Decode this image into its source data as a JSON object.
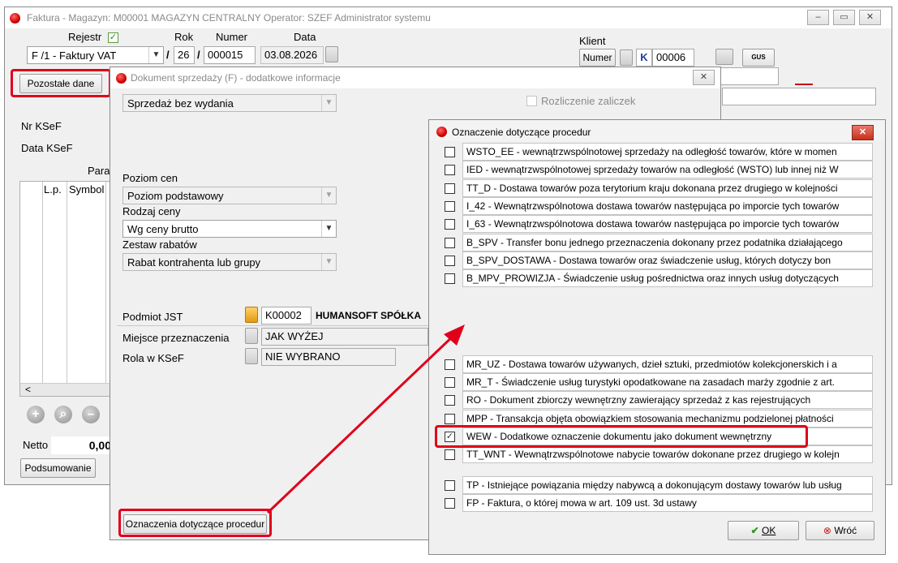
{
  "main_window": {
    "title": "Faktura - Magazyn: M00001 MAGAZYN CENTRALNY  Operator: SZEF Administrator systemu",
    "rejestr_label": "Rejestr",
    "rok_label": "Rok",
    "numer_label": "Numer",
    "data_label": "Data",
    "rejestr_value": "F /1  - Faktury VAT",
    "rok_value": "26",
    "numer_value": "000015",
    "data_value": "03.08.2026",
    "slash": "/",
    "klient_label": "Klient",
    "numer_button": "Numer",
    "k_label": "K",
    "klient_value": "00006",
    "gus_label": "GUS",
    "pozostale_button": "Pozostałe dane",
    "nr_ksef_label": "Nr KSeF",
    "data_ksef_label": "Data KSeF",
    "para_label": "Para",
    "grid_lp": "L.p.",
    "grid_symbol": "Symbol",
    "scroll_left": "<",
    "netto_label": "Netto",
    "netto_value": "0,00",
    "podsumowanie_button": "Podsumowanie"
  },
  "sales_dialog": {
    "title": "Dokument sprzedaży (F) - dodatkowe informacje",
    "sprzedaz_value": "Sprzedaż bez wydania",
    "rozliczenie_label": "Rozliczenie zaliczek",
    "poziom_cen_label": "Poziom cen",
    "poziom_cen_value": "Poziom podstawowy",
    "rodzaj_ceny_label": "Rodzaj ceny",
    "rodzaj_ceny_value": "Wg ceny brutto",
    "zestaw_rabatow_label": "Zestaw rabatów",
    "zestaw_rabatow_value": "Rabat kontrahenta lub grupy",
    "podmiot_jst_label": "Podmiot JST",
    "podmiot_code": "K00002",
    "podmiot_name": "HUMANSOFT SPÓŁKA",
    "miejsce_label": "Miejsce przeznaczenia",
    "miejsce_value": "JAK WYŻEJ",
    "rola_label": "Rola w KSeF",
    "rola_value": "NIE WYBRANO",
    "oznaczenia_button": "Oznaczenia dotyczące procedur"
  },
  "procedures_dialog": {
    "title": "Oznaczenie dotyczące procedur",
    "items_top": [
      {
        "text": "WSTO_EE - wewnątrzwspólnotowej sprzedaży na odległość towarów, które w momen",
        "checked": false
      },
      {
        "text": "IED - wewnątrzwspólnotowej sprzedaży towarów na odległość (WSTO) lub innej niż W",
        "checked": false
      },
      {
        "text": "TT_D - Dostawa towarów poza terytorium kraju dokonana przez drugiego w kolejności",
        "checked": false
      },
      {
        "text": "I_42 - Wewnątrzwspólnotowa dostawa towarów następująca po imporcie tych towarów",
        "checked": false
      },
      {
        "text": "I_63 - Wewnątrzwspólnotowa dostawa towarów następująca po imporcie tych towarów",
        "checked": false
      },
      {
        "text": "B_SPV - Transfer bonu jednego przeznaczenia dokonany przez podatnika działającego",
        "checked": false
      },
      {
        "text": "B_SPV_DOSTAWA - Dostawa towarów oraz świadczenie usług, których dotyczy bon",
        "checked": false
      },
      {
        "text": "B_MPV_PROWIZJA - Świadczenie usług pośrednictwa oraz innych usług dotyczących",
        "checked": false
      }
    ],
    "items_mid": [
      {
        "text": "MR_UZ - Dostawa towarów używanych, dzieł sztuki, przedmiotów kolekcjonerskich i a",
        "checked": false
      },
      {
        "text": "MR_T - Świadczenie usług turystyki opodatkowane na zasadach marży zgodnie z art.",
        "checked": false
      },
      {
        "text": "RO - Dokument zbiorczy wewnętrzny zawierający sprzedaż z kas rejestrujących",
        "checked": false
      },
      {
        "text": "MPP - Transakcja objęta obowiązkiem stosowania mechanizmu podzielonej płatności",
        "checked": false
      },
      {
        "text": "WEW - Dodatkowe oznaczenie dokumentu jako dokument wewnętrzny",
        "checked": true
      },
      {
        "text": "TT_WNT - Wewnątrzwspólnotowe nabycie towarów dokonane przez drugiego w kolejn",
        "checked": false
      }
    ],
    "items_bottom": [
      {
        "text": "TP - Istniejące powiązania między nabywcą a dokonującym dostawy towarów lub usług",
        "checked": false
      },
      {
        "text": "FP - Faktura, o której mowa w art. 109 ust. 3d ustawy",
        "checked": false
      }
    ],
    "ok_button": "OK",
    "cancel_button": "Wróć"
  },
  "colors": {
    "highlight": "#e0001b",
    "window_bg": "#f0f0f0"
  }
}
